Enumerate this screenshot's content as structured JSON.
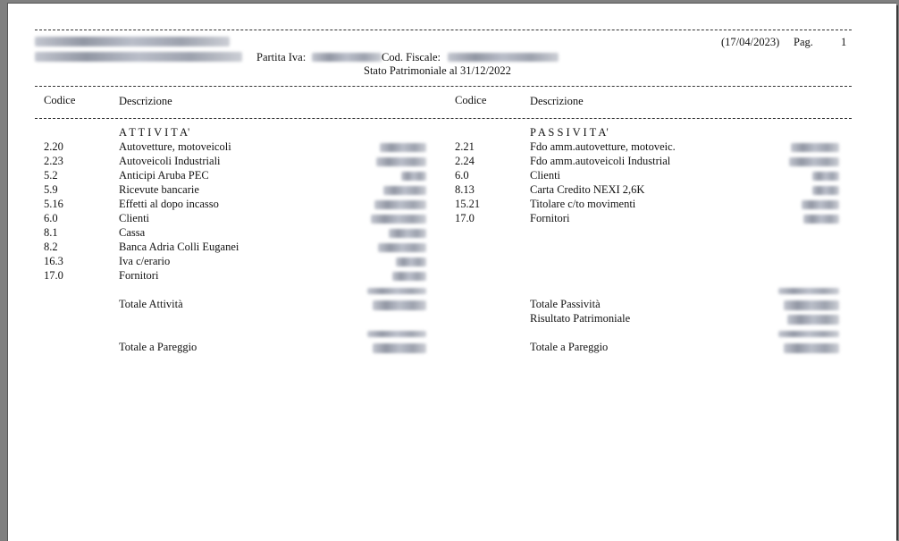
{
  "header": {
    "date": "(17/04/2023)",
    "page_label": "Pag.",
    "page_number": "1",
    "partita_iva_label": "Partita Iva:",
    "cod_fiscale_label": "Cod. Fiscale:",
    "report_title": "Stato Patrimoniale al 31/12/2022"
  },
  "columns": {
    "left_codice": "Codice",
    "left_descrizione": "Descrizione",
    "right_codice": "Codice",
    "right_descrizione": "Descrizione"
  },
  "attivita": {
    "section_title": "A T T I V I T A'",
    "rows": [
      {
        "code": "2.20",
        "desc": "Autovetture, motoveicoli"
      },
      {
        "code": "2.23",
        "desc": "Autoveicoli Industriali"
      },
      {
        "code": "5.2",
        "desc": "Anticipi Aruba PEC"
      },
      {
        "code": "5.9",
        "desc": "Ricevute bancarie"
      },
      {
        "code": "5.16",
        "desc": "Effetti al dopo incasso"
      },
      {
        "code": "6.0",
        "desc": "Clienti"
      },
      {
        "code": "8.1",
        "desc": "Cassa"
      },
      {
        "code": "8.2",
        "desc": "Banca Adria Colli Euganei"
      },
      {
        "code": "16.3",
        "desc": "Iva c/erario"
      },
      {
        "code": "17.0",
        "desc": "Fornitori"
      }
    ],
    "total_label": "Totale Attività",
    "pareggio_label": "Totale a Pareggio"
  },
  "passivita": {
    "section_title": "P A S S I V I T A'",
    "rows": [
      {
        "code": "2.21",
        "desc": "Fdo amm.autovetture, motoveic."
      },
      {
        "code": "2.24",
        "desc": "Fdo amm.autoveicoli Industrial"
      },
      {
        "code": "6.0",
        "desc": "Clienti"
      },
      {
        "code": "8.13",
        "desc": "Carta Credito NEXI 2,6K"
      },
      {
        "code": "15.21",
        "desc": "Titolare c/to movimenti"
      },
      {
        "code": "17.0",
        "desc": "Fornitori"
      }
    ],
    "total_label": "Totale Passività",
    "risultato_label": "Risultato Patrimoniale",
    "pareggio_label": "Totale a Pareggio"
  }
}
